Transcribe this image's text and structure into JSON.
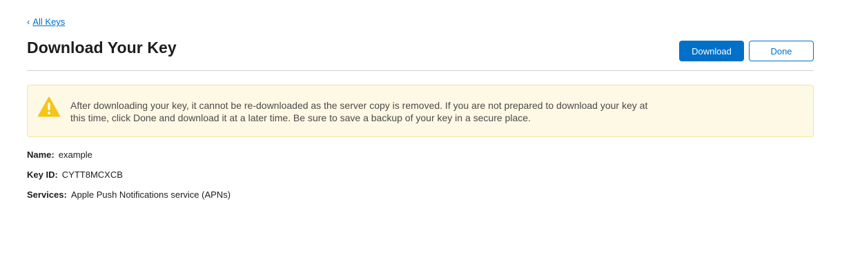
{
  "nav": {
    "back_label": "All Keys",
    "back_chevron": "‹"
  },
  "page": {
    "title": "Download Your Key"
  },
  "actions": {
    "download_label": "Download",
    "done_label": "Done"
  },
  "notice": {
    "icon": "warning-icon",
    "text": "After downloading your key, it cannot be re-downloaded as the server copy is removed. If you are not prepared to download your key at this time, click Done and download it at a later time. Be sure to save a backup of your key in a secure place."
  },
  "details": {
    "name_label": "Name:",
    "name_value": "example",
    "keyid_label": "Key ID:",
    "keyid_value": "CYTT8MCXCB",
    "services_label": "Services:",
    "services_value": "Apple Push Notifications service (APNs)"
  },
  "colors": {
    "accent": "#0070c9",
    "notice_bg": "#fef9e5",
    "warning": "#f5c518"
  }
}
